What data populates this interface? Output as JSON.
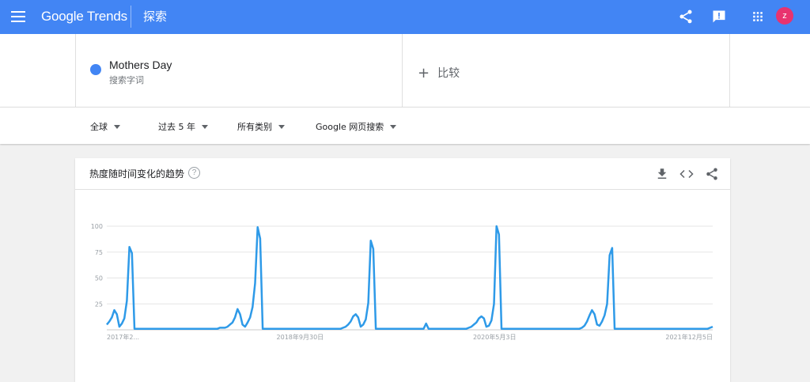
{
  "header": {
    "logo": "Google Trends",
    "title": "探索",
    "avatar_letter": "z",
    "brand_color": "#4285f4"
  },
  "search": {
    "term": "Mothers Day",
    "term_type": "搜索字词",
    "term_color": "#4285f4",
    "compare_label": "比较"
  },
  "filters": {
    "region": "全球",
    "time": "过去 5 年",
    "category": "所有类别",
    "property": "Google 网页搜索"
  },
  "card": {
    "title": "热度随时间变化的趋势",
    "help": "?"
  },
  "chart_data": {
    "type": "line",
    "ylim": [
      0,
      100
    ],
    "yticks": [
      25,
      50,
      75,
      100
    ],
    "x_tick_labels": [
      "2017年2...",
      "2018年9月30日",
      "2020年5月3日",
      "2021年12月5日"
    ],
    "series": [
      {
        "color": "#2e9ae8",
        "values": [
          5,
          8,
          12,
          19,
          15,
          3,
          6,
          11,
          28,
          80,
          74,
          1,
          1,
          1,
          1,
          1,
          1,
          1,
          1,
          1,
          1,
          1,
          1,
          1,
          1,
          1,
          1,
          1,
          1,
          1,
          1,
          1,
          1,
          1,
          1,
          1,
          1,
          1,
          1,
          1,
          1,
          1,
          1,
          1,
          1,
          2,
          2,
          2,
          3,
          5,
          7,
          12,
          20,
          15,
          5,
          3,
          7,
          12,
          22,
          45,
          99,
          88,
          1,
          1,
          1,
          1,
          1,
          1,
          1,
          1,
          1,
          1,
          1,
          1,
          1,
          1,
          1,
          1,
          1,
          1,
          1,
          1,
          1,
          1,
          1,
          1,
          1,
          1,
          1,
          1,
          1,
          1,
          1,
          1,
          2,
          3,
          5,
          8,
          13,
          15,
          12,
          3,
          5,
          10,
          26,
          86,
          78,
          1,
          1,
          1,
          1,
          1,
          1,
          1,
          1,
          1,
          1,
          1,
          1,
          1,
          1,
          1,
          1,
          1,
          1,
          1,
          1,
          6,
          1,
          1,
          1,
          1,
          1,
          1,
          1,
          1,
          1,
          1,
          1,
          1,
          1,
          1,
          1,
          1,
          2,
          3,
          5,
          7,
          11,
          13,
          11,
          3,
          4,
          9,
          25,
          100,
          92,
          1,
          1,
          1,
          1,
          1,
          1,
          1,
          1,
          1,
          1,
          1,
          1,
          1,
          1,
          1,
          1,
          1,
          1,
          1,
          1,
          1,
          1,
          1,
          1,
          1,
          1,
          1,
          1,
          1,
          1,
          1,
          1,
          2,
          4,
          8,
          14,
          19,
          15,
          5,
          4,
          8,
          14,
          25,
          72,
          79,
          1,
          1,
          1,
          1,
          1,
          1,
          1,
          1,
          1,
          1,
          1,
          1,
          1,
          1,
          1,
          1,
          1,
          1,
          1,
          1,
          1,
          1,
          1,
          1,
          1,
          1,
          1,
          1,
          1,
          1,
          1,
          1,
          1,
          1,
          1,
          1,
          1,
          1,
          2,
          3
        ]
      }
    ]
  }
}
